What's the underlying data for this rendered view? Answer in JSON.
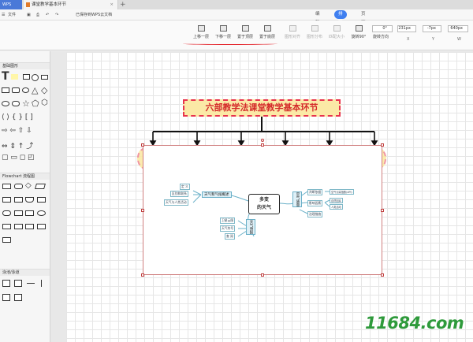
{
  "titlebar": {
    "app_tab": "WPS",
    "doc_tab": "课堂教学基本环节",
    "close": "×",
    "new_tab": "+"
  },
  "menubar": {
    "file": "文件",
    "sync_status": "已保存到WPS云文档"
  },
  "view_tabs": [
    {
      "label": "编辑",
      "active": false
    },
    {
      "label": "排列",
      "active": true
    },
    {
      "label": "页面",
      "active": false
    }
  ],
  "toolbar": {
    "buttons": [
      {
        "label": "上移一层",
        "enabled": true,
        "icon": "bring-forward-icon"
      },
      {
        "label": "下移一层",
        "enabled": true,
        "icon": "send-backward-icon"
      },
      {
        "label": "置于顶层",
        "enabled": true,
        "icon": "bring-to-front-icon"
      },
      {
        "label": "置于底层",
        "enabled": true,
        "icon": "send-to-back-icon"
      },
      {
        "label": "图形对齐",
        "enabled": false,
        "icon": "align-icon"
      },
      {
        "label": "图形分布",
        "enabled": false,
        "icon": "distribute-icon"
      },
      {
        "label": "匹配大小",
        "enabled": false,
        "icon": "match-size-icon"
      },
      {
        "label": "旋转90°",
        "enabled": true,
        "icon": "rotate-icon"
      },
      {
        "label": "旋转方向",
        "enabled": true,
        "icon": "rotate-direction-icon"
      }
    ],
    "fields": [
      {
        "value": "0°",
        "label": ""
      },
      {
        "value": "231px",
        "label": "X"
      },
      {
        "value": "-7px",
        "label": "Y"
      },
      {
        "value": "640px",
        "label": "W"
      }
    ]
  },
  "left_panel": {
    "sections": [
      {
        "title": "基础图形"
      },
      {
        "title": "Flowchart 流程图"
      },
      {
        "title": "泳池/泳道"
      }
    ]
  },
  "diagram": {
    "title": "六部教学法课堂教学基本环节"
  },
  "mindmap": {
    "center_line1": "多变",
    "center_line2": "的天气",
    "branches": {
      "left_top": "天气和气候概述",
      "left_bottom": "天气预报",
      "right": "空气质量"
    },
    "leaves": {
      "l1": "定  义",
      "l2": "区别和联系",
      "l3": "天气与人类活动",
      "l4": "卫星云图",
      "l5": "天气符号",
      "l6": "查  阅",
      "r1": "判断依据",
      "r2": "影响因素",
      "r3": "治理措施",
      "r1a": "空气污染指数(API)",
      "r2a": "自然因素",
      "r2b": "人类活动"
    }
  },
  "watermark": "11684.com"
}
